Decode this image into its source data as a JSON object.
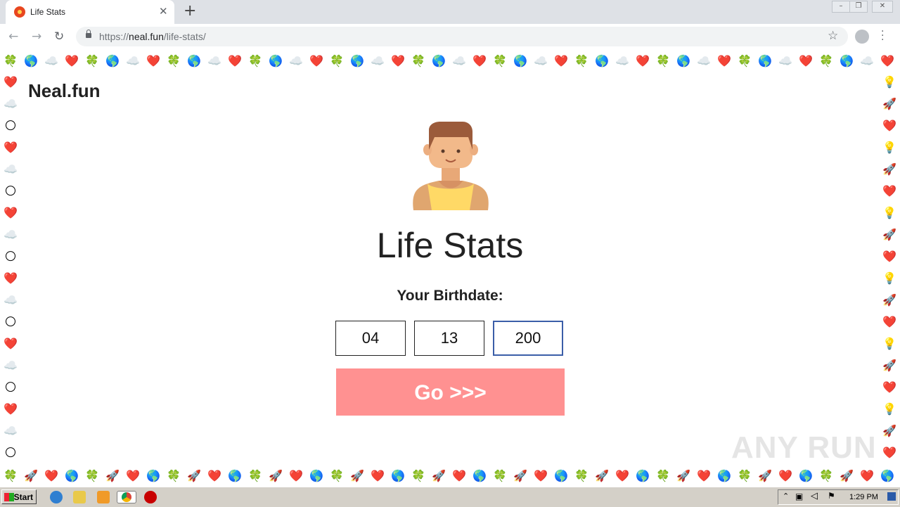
{
  "browser": {
    "tab_title": "Life Stats",
    "url_prefix": "https://",
    "url_host": "neal.fun",
    "url_path": "/life-stats/"
  },
  "page": {
    "brand": "Neal.fun",
    "title": "Life Stats",
    "birthdate_label": "Your Birthdate:",
    "month_value": "04",
    "day_value": "13",
    "year_value": "200",
    "go_label": "Go >>>",
    "watermark": "ANY RUN"
  },
  "taskbar": {
    "start_label": "Start",
    "clock": "1:29 PM"
  },
  "colors": {
    "go_button": "#ff9191",
    "tabbar": "#dee1e6",
    "taskbar": "#d4d0c8"
  }
}
